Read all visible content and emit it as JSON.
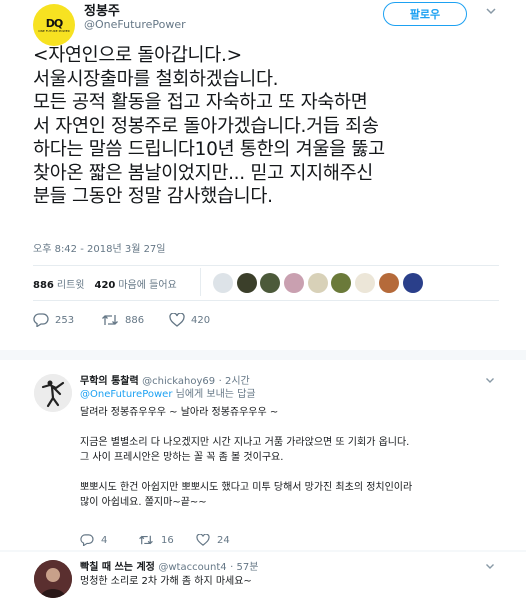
{
  "tweet": {
    "author_name": "정봉주",
    "author_handle": "@OneFuturePower",
    "avatar_logo": "DQ",
    "avatar_subtext": "ONE FUTURE POWER",
    "follow_label": "팔로우",
    "text": "<자연인으로 돌아갑니다.>\n서울시장출마를 철회하겠습니다.\n모든 공적 활동을 접고 자숙하고 또 자숙하면\n서 자연인 정봉주로 돌아가겠습니다.거듭 죄송\n하다는 말씀 드립니다10년 통한의 겨울을 뚫고\n찾아온 짧은 봄날이었지만... 믿고 지지해주신\n분들 그동안 정말 감사했습니다.",
    "timestamp": "오후 8:42 - 2018년 3월 27일",
    "retweets_count": "886",
    "retweets_label": "리트윗",
    "likes_count": "420",
    "likes_label": "마음에 들어요",
    "reply_count": "253",
    "retweet_action_count": "886",
    "like_action_count": "420"
  },
  "replies": [
    {
      "name": "무학의 통찰력",
      "handle": "@chickahoy69",
      "time": "· 2시간",
      "mention": "@OneFuturePower",
      "reply_to_suffix": " 님에게 보내는 답글",
      "body": "달려라 정봉쥬우우우 ~ 날아라 정봉쥬우우우 ~\n\n지금은 별별소리 다 나오겠지만 시간 지나고 거품 가라앉으면 또 기회가 옵니다.\n그 사이 프레시안은 망하는 꼴 꼭 좀 볼 것이구요.\n\n뽀뽀시도 한건 아쉽지만 뽀뽀시도 했다고 미투 당해서 망가진 최초의 정치인이라\n많이 아쉽네요. 쫄지마~끝~~",
      "reply_count": "4",
      "retweet_count": "16",
      "like_count": "24"
    },
    {
      "name": "빡칠 때 쓰는 계정",
      "handle": "@wtaccount4",
      "time": "· 57분",
      "body": "멍청한 소리로 2차 가해 좀 하지 마세요~"
    }
  ],
  "colors": {
    "accent": "#1da1f2",
    "secondary_text": "#657786",
    "primary_text": "#14171a",
    "avatar_bg": "#f7e221"
  },
  "icons": [
    "chevron-down-icon",
    "reply-icon",
    "retweet-icon",
    "heart-icon"
  ]
}
